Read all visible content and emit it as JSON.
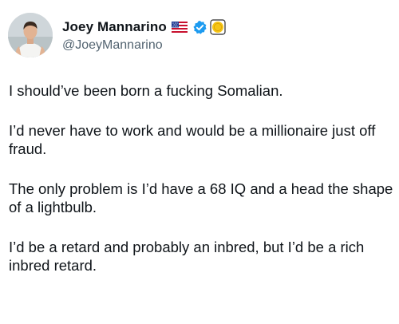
{
  "author": {
    "display_name": "Joey Mannarino",
    "handle": "@JoeyMannarino",
    "icons": [
      "us-flag-icon",
      "verified-badge-icon",
      "gold-coin-badge-icon"
    ]
  },
  "tweet": {
    "paragraphs": [
      "I should’ve been born a fucking Somalian.",
      "I’d never have to work and would be a millionaire just off fraud.",
      "The only problem is I’d have a 68 IQ and a head the shape of a lightbulb.",
      "I’d be a retard and probably an inbred, but I’d be a rich inbred retard."
    ]
  },
  "colors": {
    "text": "#0f1419",
    "secondary_text": "#536471",
    "verified_blue": "#1d9bf0",
    "gold_badge": "#f5c518"
  }
}
